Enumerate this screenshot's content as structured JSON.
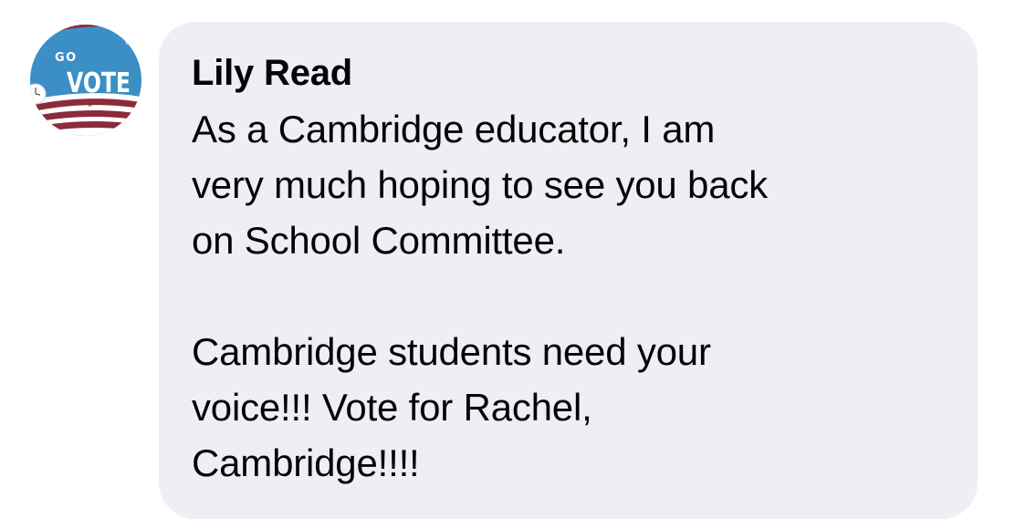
{
  "comment": {
    "avatar": {
      "icon": "go-vote-badge-icon",
      "small_text": "GO",
      "big_text": "VOTE",
      "colors": {
        "blue": "#3b8fc4",
        "red": "#8c2b3a",
        "white": "#ffffff"
      }
    },
    "author": "Lily Read",
    "paragraphs": [
      {
        "lines": [
          "As a Cambridge educator, I am",
          "very much hoping to see you back",
          "on School Committee."
        ]
      },
      {
        "lines": [
          "Cambridge students need your",
          "voice!!! Vote for Rachel,",
          "Cambridge!!!!"
        ]
      }
    ],
    "bubble_color": "#eeeff4",
    "text_color": "#050505"
  }
}
